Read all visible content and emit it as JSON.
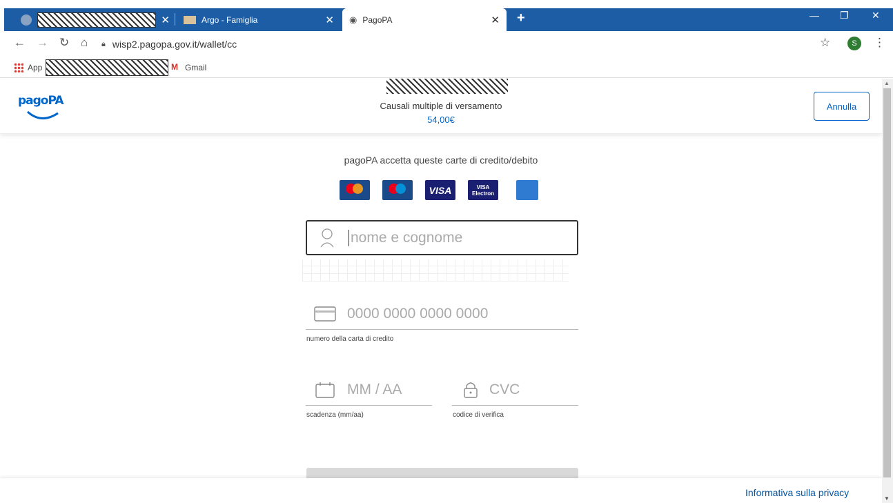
{
  "browser": {
    "tabs": [
      {
        "label": ""
      },
      {
        "label": "Argo - Famiglia"
      },
      {
        "label": "PagoPA"
      }
    ],
    "new_tab_icon": "plus-icon",
    "url": "wisp2.pagopa.gov.it/wallet/cc",
    "profile_initial": "S",
    "bookmarks": {
      "apps_label": "App",
      "gmail_label": "Gmail"
    }
  },
  "header": {
    "logo": "pagoPA",
    "description": "Causali multiple di versamento",
    "amount": "54,00€",
    "cancel_label": "Annulla"
  },
  "form": {
    "accepted_cards_text": "pagoPA accetta queste carte di credito/debito",
    "cards": [
      "mastercard",
      "maestro",
      "VISA",
      "VISA Electron",
      "american-express"
    ],
    "name_placeholder": "nome e cognome",
    "card_number_placeholder": "0000 0000 0000 0000",
    "card_number_hint": "numero della carta di credito",
    "expiry_placeholder": "MM / AA",
    "expiry_hint": "scadenza (mm/aa)",
    "cvc_placeholder": "CVC",
    "cvc_hint": "codice di verifica"
  },
  "footer": {
    "privacy_link": "Informativa sulla privacy"
  },
  "colors": {
    "accent": "#0066cc",
    "tabbar": "#1d5da6",
    "visa": "#1a1f71"
  }
}
